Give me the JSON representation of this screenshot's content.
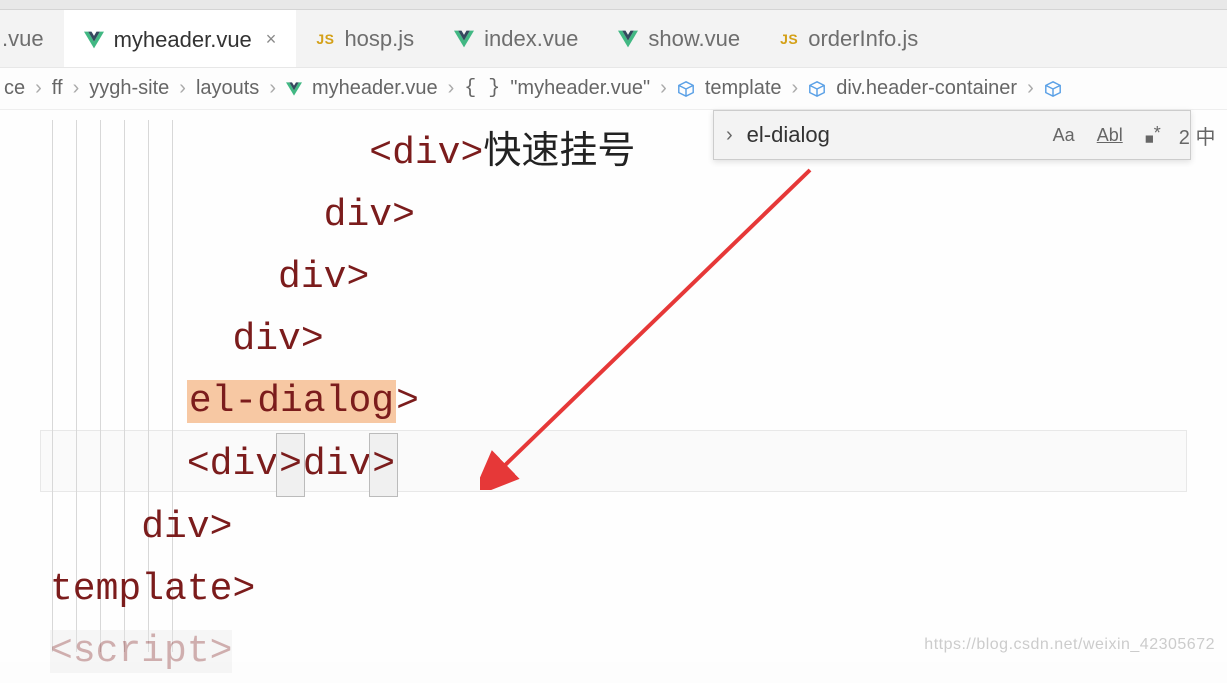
{
  "tabs": [
    {
      "label": ".vue",
      "type": "vue",
      "active": false
    },
    {
      "label": "myheader.vue",
      "type": "vue",
      "active": true,
      "closable": true
    },
    {
      "label": "hosp.js",
      "type": "js",
      "active": false
    },
    {
      "label": "index.vue",
      "type": "vue",
      "active": false
    },
    {
      "label": "show.vue",
      "type": "vue",
      "active": false
    },
    {
      "label": "orderInfo.js",
      "type": "js",
      "active": false
    }
  ],
  "breadcrumb": {
    "items": [
      "ce",
      "ff",
      "yygh-site",
      "layouts",
      "myheader.vue",
      "\"myheader.vue\"",
      "template",
      "div.header-container"
    ],
    "icons": [
      "",
      "",
      "",
      "",
      "vue",
      "brace",
      "cube",
      "cube",
      "cube"
    ]
  },
  "find": {
    "value": "el-dialog",
    "match_count": "2 中",
    "case_label": "Aa",
    "word_label": "Abl",
    "regex_label": ".*"
  },
  "code": {
    "lines": [
      {
        "indent": 14,
        "prefix": "<",
        "tag": "div",
        "suffix": ">",
        "text": "快速挂号"
      },
      {
        "indent": 12,
        "prefix": "</",
        "tag": "div",
        "suffix": ">"
      },
      {
        "indent": 10,
        "prefix": "</",
        "tag": "div",
        "suffix": ">"
      },
      {
        "indent": 8,
        "prefix": "</",
        "tag": "div",
        "suffix": ">"
      },
      {
        "indent": 6,
        "prefix": "</",
        "tag": "el-dialog",
        "suffix": ">",
        "highlight": true
      },
      {
        "indent": 6,
        "prefix": "<",
        "tag": "div",
        "suffix": ">",
        "extra_close": "</",
        "extra_tag": "div",
        "extra_suffix": ">",
        "cursor": true
      },
      {
        "indent": 4,
        "prefix": "</",
        "tag": "div",
        "suffix": ">"
      },
      {
        "indent": 0,
        "prefix": "</",
        "tag": "template",
        "suffix": ">"
      },
      {
        "indent": 0,
        "prefix": "<",
        "tag": "script",
        "suffix": ">",
        "faded": true
      }
    ]
  },
  "watermark": "https://blog.csdn.net/weixin_42305672"
}
